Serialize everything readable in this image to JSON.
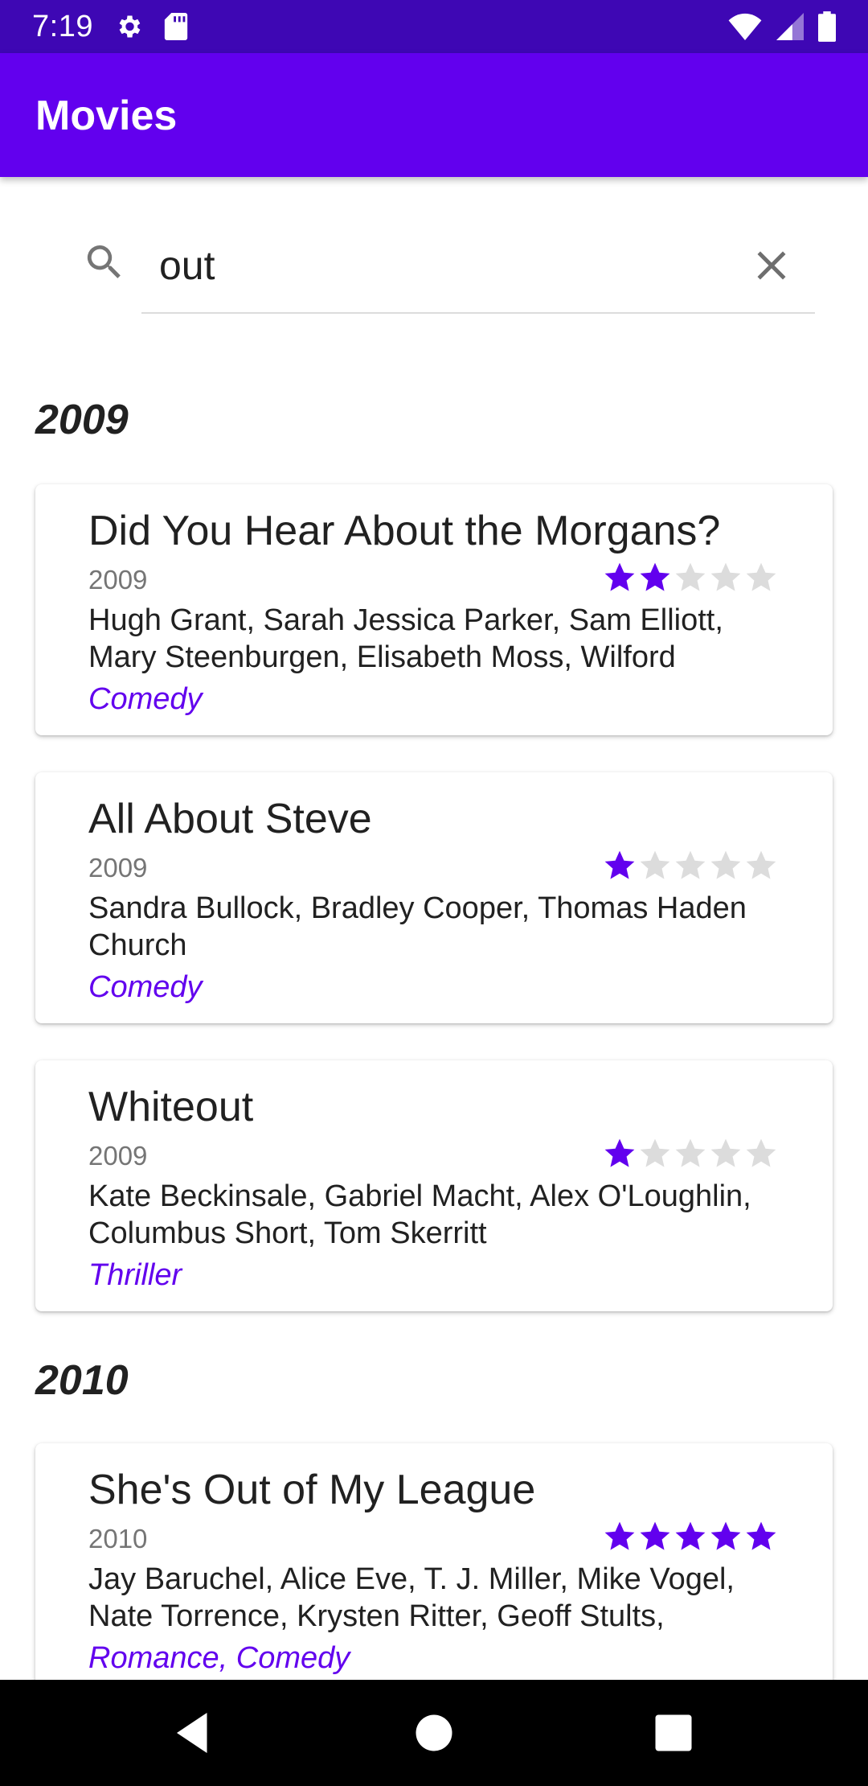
{
  "status_bar": {
    "time": "7:19",
    "icons": [
      "settings-icon",
      "sd-card-icon",
      "wifi-icon",
      "signal-icon",
      "battery-icon"
    ]
  },
  "app_bar": {
    "title": "Movies"
  },
  "search": {
    "value": "out",
    "placeholder": ""
  },
  "sections": [
    {
      "year": "2009",
      "movies": [
        {
          "title": "Did You Hear About the Morgans?",
          "year": "2009",
          "rating": 2,
          "cast": "Hugh Grant, Sarah Jessica Parker, Sam Elliott, Mary Steenburgen, Elisabeth Moss, Wilford",
          "genre": "Comedy"
        },
        {
          "title": "All About Steve",
          "year": "2009",
          "rating": 1,
          "cast": "Sandra Bullock, Bradley Cooper, Thomas Haden Church",
          "genre": "Comedy"
        },
        {
          "title": "Whiteout",
          "year": "2009",
          "rating": 1,
          "cast": "Kate Beckinsale, Gabriel Macht, Alex O'Loughlin, Columbus Short, Tom Skerritt",
          "genre": "Thriller"
        }
      ]
    },
    {
      "year": "2010",
      "movies": [
        {
          "title": "She's Out of My League",
          "year": "2010",
          "rating": 5,
          "cast": "Jay Baruchel, Alice Eve, T. J. Miller, Mike Vogel, Nate Torrence, Krysten Ritter, Geoff Stults,",
          "genre": "Romance, Comedy"
        }
      ]
    }
  ],
  "rating_max": 5,
  "colors": {
    "status_bar": "#3e07b4",
    "app_bar": "#6200ee",
    "accent": "#6200ee",
    "star_empty": "#dcdcdc"
  }
}
